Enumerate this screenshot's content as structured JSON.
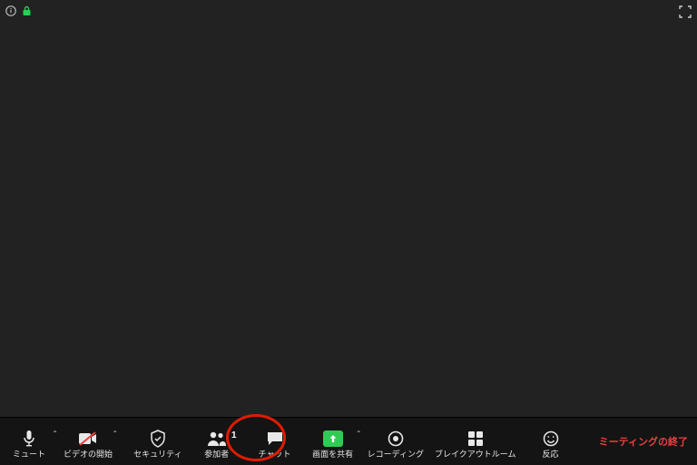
{
  "top": {},
  "toolbar": {
    "mute": {
      "label": "ミュート"
    },
    "video": {
      "label": "ビデオの開始"
    },
    "security": {
      "label": "セキュリティ"
    },
    "participants": {
      "label": "参加者",
      "count": "1"
    },
    "chat": {
      "label": "チャット"
    },
    "share": {
      "label": "画面を共有"
    },
    "record": {
      "label": "レコーディング"
    },
    "breakout": {
      "label": "ブレイクアウトルーム"
    },
    "reactions": {
      "label": "反応"
    },
    "end": {
      "label": "ミーティングの終了"
    }
  },
  "colors": {
    "accent_green": "#2ecc54",
    "end_red": "#ec4040",
    "annotation_red": "#e11b00"
  }
}
